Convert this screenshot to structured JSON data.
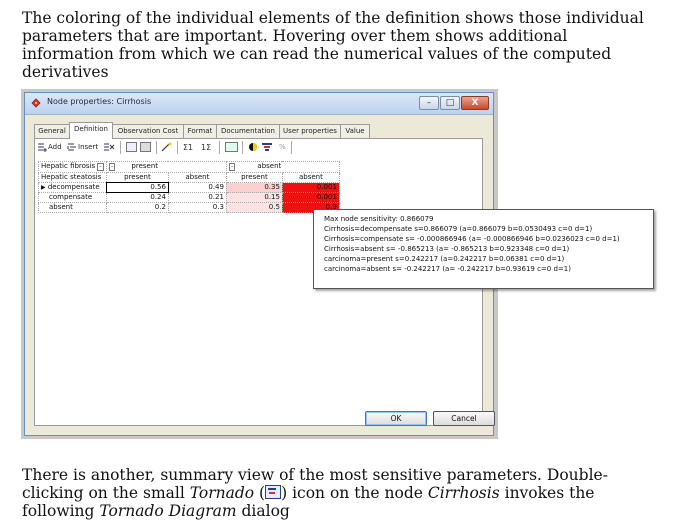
{
  "doc": {
    "intro_text": "The coloring of the individual elements of the definition shows those individual parameters that are important. Hovering over them shows additional information from which we can read the numerical values of the computed derivatives",
    "outro_part1": "There is another, summary view of the most sensitive parameters. Double-clicking on the small ",
    "outro_tornado": "Tornado",
    "outro_part2": " icon on the node ",
    "outro_node": "Cirrhosis",
    "outro_part3": " invokes the following ",
    "outro_dialog": "Tornado Diagram",
    "outro_part4": " dialog"
  },
  "window": {
    "title": "Node properties: Cirrhosis",
    "minimize": "–",
    "maximize": "□",
    "close": "X"
  },
  "tabs": [
    "General",
    "Definition",
    "Observation Cost",
    "Format",
    "Documentation",
    "User properties",
    "Value"
  ],
  "toolbar": {
    "add_label": "Add",
    "insert_label": "Insert",
    "percent_label": "%"
  },
  "table": {
    "parent1_label": "Hepatic fibrosis",
    "parent2_label": "Hepatic steatosis",
    "fibrosis_states": [
      "present",
      "absent"
    ],
    "steatosis_states": [
      "present",
      "absent",
      "present",
      "absent"
    ],
    "rows": [
      {
        "state": "decompensate",
        "values": [
          "0.56",
          "0.49",
          "0.35",
          "0.001"
        ]
      },
      {
        "state": "compensate",
        "values": [
          "0.24",
          "0.21",
          "0.15",
          "0.001"
        ]
      },
      {
        "state": "absent",
        "values": [
          "0.2",
          "0.3",
          "0.5",
          "0.9"
        ]
      }
    ]
  },
  "tooltip": {
    "lines": [
      "Max node sensitivity: 0.866079",
      "Cirrhosis=decompensate s=0.866079 (a=0.866079 b=0.0530493 c=0 d=1)",
      "Cirrhosis=compensate s= -0.000866946 (a= -0.000866946 b=0.0236023 c=0 d=1)",
      "Cirrhosis=absent s= -0.865213 (a= -0.865213 b=0.923348 c=0 d=1)",
      "carcinoma=present s=0.242217 (a=0.242217 b=0.06381 c=0 d=1)",
      "carcinoma=absent s= -0.242217 (a= -0.242217 b=0.93619 c=0 d=1)"
    ]
  },
  "buttons": {
    "ok": "OK",
    "cancel": "Cancel"
  },
  "colors": {
    "highlight_red": "#ee1111",
    "highlight_pink_light": "#fde4e4",
    "highlight_pink": "#fbd0d0"
  }
}
